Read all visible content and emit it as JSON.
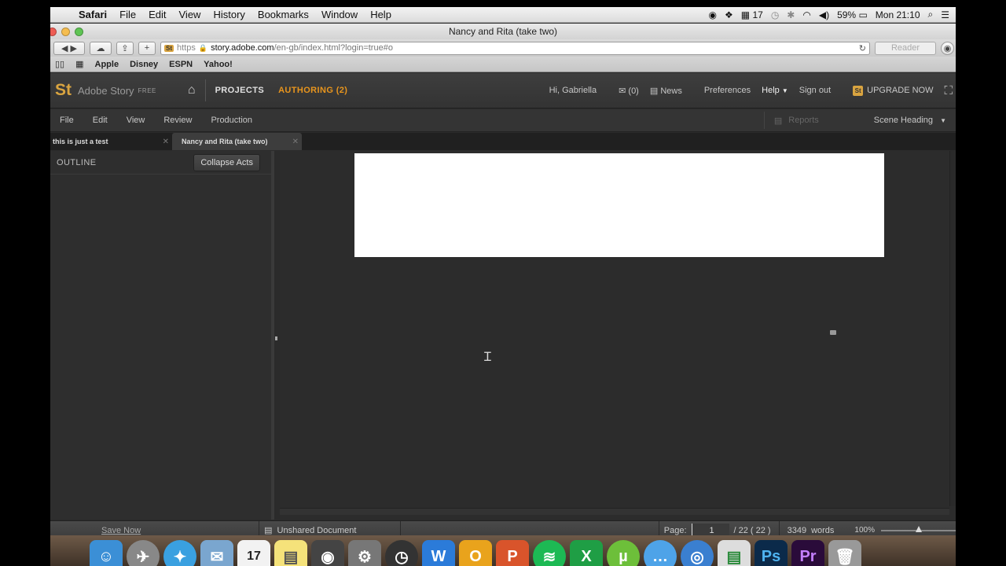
{
  "menubar": {
    "app": "Safari",
    "items": [
      "File",
      "Edit",
      "View",
      "History",
      "Bookmarks",
      "Window",
      "Help"
    ],
    "date_indicator": "17",
    "battery": "59%",
    "clock": "Mon 21:10"
  },
  "browser": {
    "window_title": "Nancy and Rita (take two)",
    "url_scheme": "https",
    "url_domain": "story.adobe.com",
    "url_path": "/en-gb/index.html?login=true#o",
    "reader_label": "Reader",
    "bookmarks": [
      "Apple",
      "Disney",
      "ESPN",
      "Yahoo!"
    ]
  },
  "app": {
    "logo": "St",
    "name": "Adobe Story",
    "edition": "FREE",
    "nav_projects": "PROJECTS",
    "nav_authoring": "AUTHORING (2)",
    "greeting": "Hi, Gabriella",
    "mail_count": "(0)",
    "news": "News",
    "preferences": "Preferences",
    "help": "Help",
    "sign_out": "Sign out",
    "upgrade": "UPGRADE NOW",
    "menu": [
      "File",
      "Edit",
      "View",
      "Review",
      "Production"
    ],
    "reports": "Reports",
    "scene_heading": "Scene Heading",
    "tabs": [
      {
        "label": "this is just a test"
      },
      {
        "label": "Nancy and Rita (take two)"
      }
    ],
    "outline_label": "OUTLINE",
    "collapse_acts": "Collapse Acts",
    "status": {
      "save_now": "Save Now",
      "document_state": "Unshared Document",
      "page_label": "Page:",
      "current_page": "1",
      "page_total": "/ 22 ( 22 )",
      "word_count": "3349",
      "words_label": "words",
      "zoom": "100%"
    }
  },
  "dock": {
    "apps": [
      "Finder",
      "Launchpad",
      "Safari",
      "Mail",
      "Calendar",
      "Stickies",
      "FaceTime",
      "System Preferences",
      "Dashboard",
      "Word",
      "Outlook",
      "PowerPoint",
      "Spotify",
      "Excel",
      "uTorrent",
      "Messages",
      "Network",
      "Document",
      "Photoshop",
      "Premiere",
      "Trash"
    ],
    "calendar_day": "17"
  }
}
